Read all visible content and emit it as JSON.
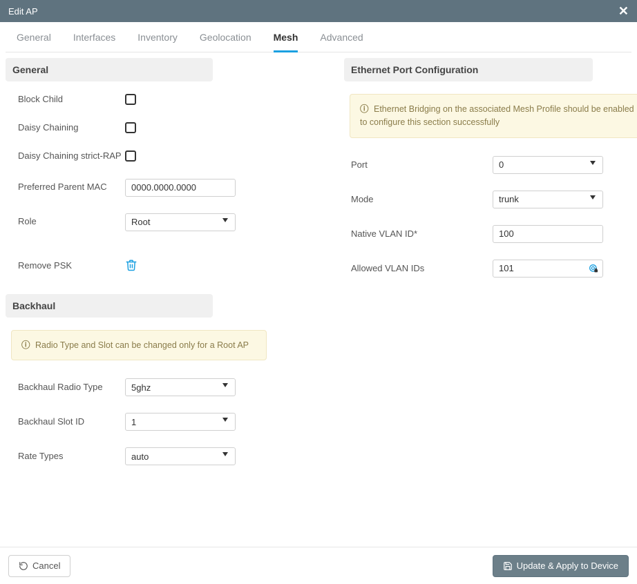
{
  "modal": {
    "title": "Edit AP"
  },
  "tabs": {
    "general": "General",
    "interfaces": "Interfaces",
    "inventory": "Inventory",
    "geolocation": "Geolocation",
    "mesh": "Mesh",
    "advanced": "Advanced"
  },
  "sections": {
    "general": "General",
    "ethernet": "Ethernet Port Configuration",
    "backhaul": "Backhaul"
  },
  "labels": {
    "block_child": "Block Child",
    "daisy_chaining": "Daisy Chaining",
    "daisy_strict_rap": "Daisy Chaining strict-RAP",
    "pref_parent_mac": "Preferred Parent MAC",
    "role": "Role",
    "remove_psk": "Remove PSK",
    "port": "Port",
    "mode": "Mode",
    "native_vlan": "Native VLAN ID*",
    "allowed_vlan": "Allowed VLAN IDs",
    "bh_radio_type": "Backhaul Radio Type",
    "bh_slot_id": "Backhaul Slot ID",
    "rate_types": "Rate Types"
  },
  "values": {
    "pref_parent_mac": "0000.0000.0000",
    "role": "Root",
    "port": "0",
    "mode": "trunk",
    "native_vlan": "100",
    "allowed_vlan": "101",
    "bh_radio_type": "5ghz",
    "bh_slot_id": "1",
    "rate_types": "auto"
  },
  "alerts": {
    "ethernet": "Ethernet Bridging on the associated Mesh Profile should be enabled to configure this section successfully",
    "backhaul": "Radio Type and Slot can be changed only for a Root AP"
  },
  "footer": {
    "cancel": "Cancel",
    "apply": "Update & Apply to Device"
  }
}
